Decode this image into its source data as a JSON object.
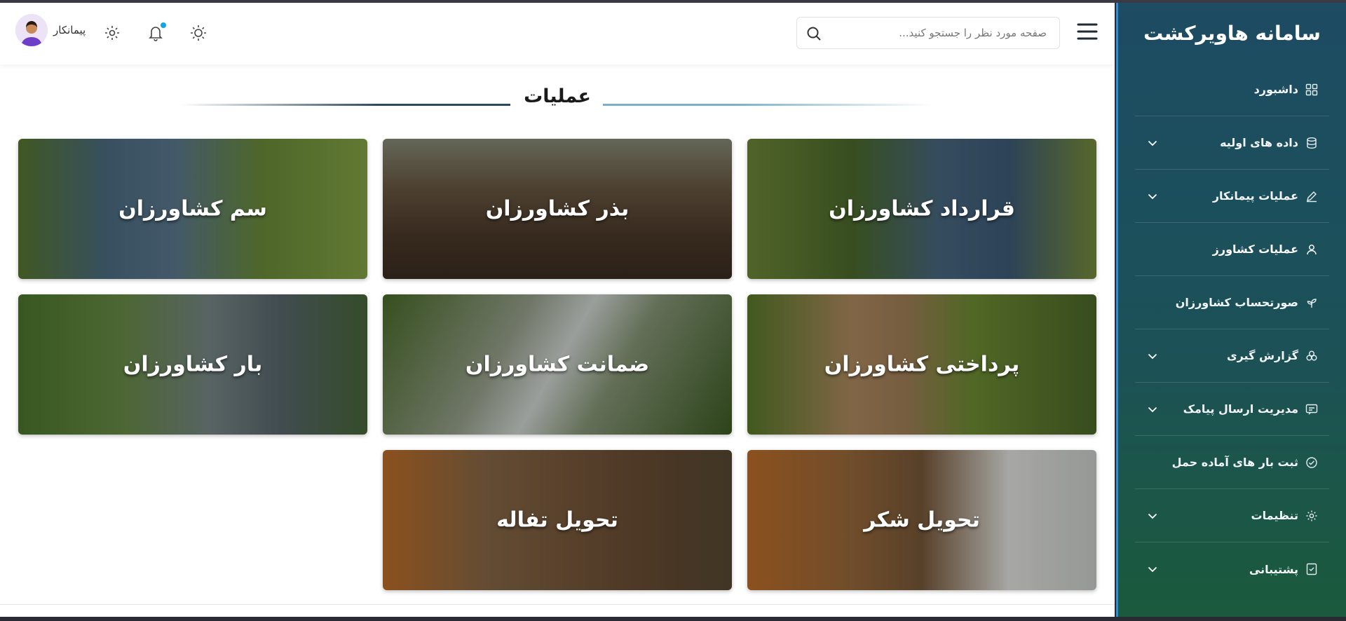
{
  "sidebar": {
    "title": "سامانه هاویرکشت",
    "items": [
      {
        "label": "داشبورد",
        "icon": "dashboard-icon",
        "has_chevron": false
      },
      {
        "label": "داده های اولیه",
        "icon": "database-icon",
        "has_chevron": true
      },
      {
        "label": "عملیات پیمانکار",
        "icon": "pen-icon",
        "has_chevron": true
      },
      {
        "label": "عملیات کشاورز",
        "icon": "user-icon",
        "has_chevron": false,
        "active": true
      },
      {
        "label": "صورتحساب کشاورزان",
        "icon": "sprout-icon",
        "has_chevron": false
      },
      {
        "label": "گزارش گیری",
        "icon": "report-icon",
        "has_chevron": true
      },
      {
        "label": "مدیریت ارسال پیامک",
        "icon": "message-icon",
        "has_chevron": true
      },
      {
        "label": "ثبت بار های آماده حمل",
        "icon": "check-circle-icon",
        "has_chevron": false
      },
      {
        "label": "تنظیمات",
        "icon": "gear-icon",
        "has_chevron": true
      },
      {
        "label": "پشتیبانی",
        "icon": "support-icon",
        "has_chevron": true
      }
    ]
  },
  "header": {
    "search_placeholder": "صفحه مورد نظر را جستجو کنید...",
    "user_name": "پیمانکار",
    "icons": [
      "menu-icon",
      "search-icon",
      "sun-icon",
      "bell-icon",
      "gear-icon"
    ]
  },
  "main": {
    "section_title": "عملیات",
    "cards": [
      {
        "label": "قرارداد کشاورزان",
        "scene": "farmer-handshake"
      },
      {
        "label": "بذر کشاورزان",
        "scene": "seeds-in-hands"
      },
      {
        "label": "سم کشاورزان",
        "scene": "farmer-sprayer"
      },
      {
        "label": "پرداختی کشاورزان",
        "scene": "money-sack-field"
      },
      {
        "label": "ضمانت کشاورزان",
        "scene": "document-field"
      },
      {
        "label": "بار کشاورزان",
        "scene": "vegetables-truck"
      },
      {
        "label": "تحویل شکر",
        "scene": "truck-sugar"
      },
      {
        "label": "تحویل تفاله",
        "scene": "truck-pulp"
      }
    ]
  },
  "colors": {
    "sidebar_top": "#1d4c63",
    "sidebar_bottom": "#1b5a3c",
    "accent": "#2f8fd6",
    "notification_dot": "#0ea5e9"
  }
}
